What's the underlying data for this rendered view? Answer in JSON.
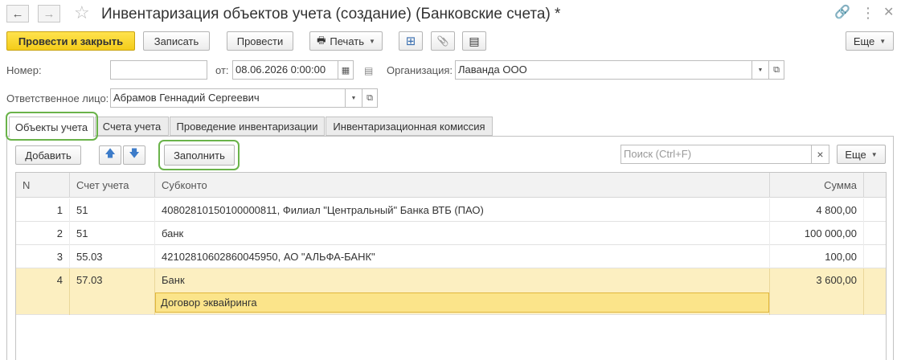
{
  "window": {
    "title": "Инвентаризация объектов учета  (создание) (Банковские счета) *",
    "back_icon": "←",
    "forward_icon": "→",
    "star_icon": "☆",
    "link_icon": "🔗",
    "more_icon": "⋮",
    "close_icon": "✕"
  },
  "toolbar": {
    "post_close_label": "Провести и закрыть",
    "save_label": "Записать",
    "post_label": "Провести",
    "print_label": "Печать",
    "print_icon": "🖶",
    "structure_icon": "⊞",
    "attach_icon": "📎",
    "report_icon": "▤",
    "more_label": "Еще"
  },
  "header": {
    "number_label": "Номер:",
    "number_value": "",
    "date_label": "от:",
    "date_value": "08.06.2026  0:00:00",
    "calendar_icon": "▦",
    "org_icon": "▤",
    "org_label": "Организация:",
    "org_value": "Лаванда ООО",
    "responsible_label": "Ответственное лицо:",
    "responsible_value": "Абрамов Геннадий Сергеевич",
    "dropdown_icon": "▼",
    "open_icon": "⧉"
  },
  "tabs": [
    {
      "label": "Объекты учета",
      "active": true
    },
    {
      "label": "Счета учета",
      "active": false
    },
    {
      "label": "Проведение инвентаризации",
      "active": false
    },
    {
      "label": "Инвентаризационная комиссия",
      "active": false
    }
  ],
  "table_toolbar": {
    "add_label": "Добавить",
    "up_icon": "🡅",
    "down_icon": "🡇",
    "fill_label": "Заполнить",
    "search_placeholder": "Поиск (Ctrl+F)",
    "clear_icon": "×",
    "more_label": "Еще"
  },
  "table": {
    "columns": [
      "N",
      "Счет учета",
      "Субконто",
      "Сумма"
    ],
    "rows": [
      {
        "n": "1",
        "account": "51",
        "subconto": "40802810150100000811, Филиал \"Центральный\" Банка ВТБ (ПАО)",
        "amount": "4 800,00"
      },
      {
        "n": "2",
        "account": "51",
        "subconto": "банк",
        "amount": "100 000,00"
      },
      {
        "n": "3",
        "account": "55.03",
        "subconto": "42102810602860045950, АО \"АЛЬФА-БАНК\"",
        "amount": "100,00"
      },
      {
        "n": "4",
        "account": "57.03",
        "subconto": "Банк",
        "subconto2": "Договор эквайринга",
        "amount": "3 600,00"
      }
    ]
  },
  "colors": {
    "accent_yellow": "#f4cc1a",
    "selected_row": "#fcefc1",
    "highlight_ring": "#6ab34a"
  }
}
